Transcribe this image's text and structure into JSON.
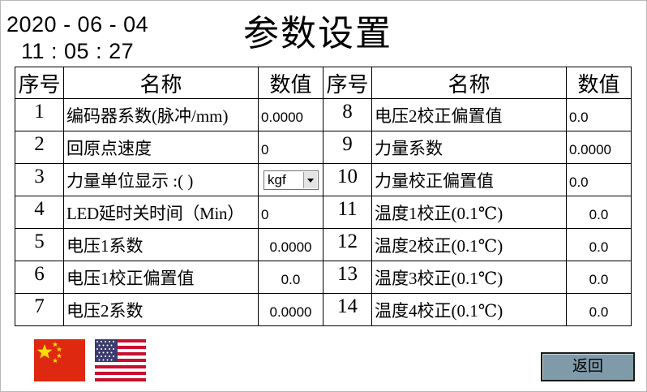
{
  "header": {
    "date": "2020 - 06 - 04",
    "time": "11 : 05 : 27",
    "title": "参数设置"
  },
  "table": {
    "headers": [
      "序号",
      "名称",
      "数值",
      "序号",
      "名称",
      "数值"
    ],
    "rows": [
      {
        "left": {
          "seq": "1",
          "name": "编码器系数(脉冲/mm)",
          "value": "0.0000"
        },
        "right": {
          "seq": "8",
          "name": "电压2校正偏置值",
          "value": "0.0"
        }
      },
      {
        "left": {
          "seq": "2",
          "name": "回原点速度",
          "value": "0"
        },
        "right": {
          "seq": "9",
          "name": "力量系数",
          "value": "0.0000"
        }
      },
      {
        "left": {
          "seq": "3",
          "name": "力量单位显示 :(     )",
          "value": "kgf"
        },
        "right": {
          "seq": "10",
          "name": "力量校正偏置值",
          "value": "0.0"
        }
      },
      {
        "left": {
          "seq": "4",
          "name": "LED延时关时间（Min）",
          "value": "0"
        },
        "right": {
          "seq": "11",
          "name": "温度1校正(0.1℃)",
          "value": "0.0"
        }
      },
      {
        "left": {
          "seq": "5",
          "name": "电压1系数",
          "value": "0.0000"
        },
        "right": {
          "seq": "12",
          "name": "温度2校正(0.1℃)",
          "value": "0.0"
        }
      },
      {
        "left": {
          "seq": "6",
          "name": "电压1校正偏置值",
          "value": "0.0"
        },
        "right": {
          "seq": "13",
          "name": "温度3校正(0.1℃)",
          "value": "0.0"
        }
      },
      {
        "left": {
          "seq": "7",
          "name": "电压2系数",
          "value": "0.0000"
        },
        "right": {
          "seq": "14",
          "name": "温度4校正(0.1℃)",
          "value": "0.0"
        }
      }
    ]
  },
  "language": {
    "flags": [
      "china-flag-icon",
      "usa-flag-icon"
    ]
  },
  "buttons": {
    "back_label": "返回"
  },
  "colors": {
    "back_button": "#7f9aa8",
    "flag_red": "#de2910",
    "flag_star": "#ffde00",
    "us_blue": "#3c3b6e",
    "us_red": "#c8102e"
  }
}
